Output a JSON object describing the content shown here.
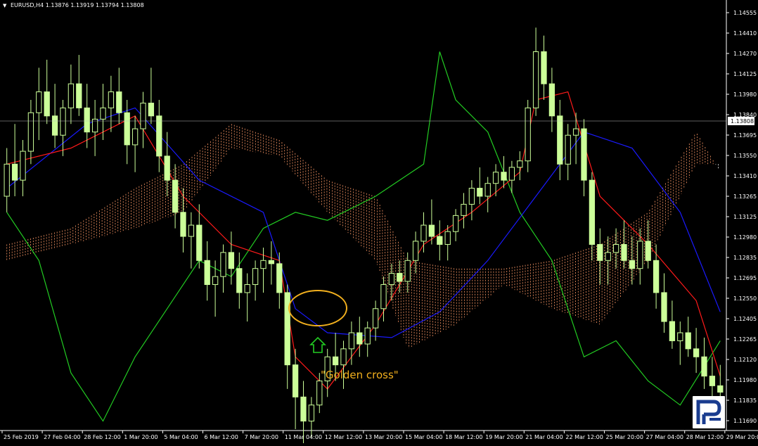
{
  "symbol_info": {
    "symbol": "EURUSD,H4",
    "ohlc": "1.13876 1.13919 1.13794 1.13808"
  },
  "annotation": {
    "label": "\"Golden cross\"",
    "color": "#f2b01e"
  },
  "colors": {
    "background": "#000000",
    "candle": "#ccff99",
    "tenkan": "#ff1a1a",
    "kijun": "#1a1aff",
    "chikou": "#22cc22",
    "cloud_bear": "#ff9966",
    "cloud_bull": "#ffffff",
    "axis": "#ffffff",
    "arrow": "#22cc22"
  },
  "icons": {
    "symbol_menu": "triangle-down-icon",
    "arrow": "arrow-up-icon",
    "logo": "roboforex-logo-icon"
  },
  "chart_data": {
    "type": "candlestick",
    "symbol": "EURUSD",
    "timeframe": "H4",
    "ylim": [
      1.1195,
      1.146
    ],
    "current_price": "1.13808",
    "y_ticks": [
      "1.14555",
      "1.14410",
      "1.14270",
      "1.14125",
      "1.13980",
      "1.13840",
      "1.13695",
      "1.13550",
      "1.13410",
      "1.13265",
      "1.13125",
      "1.12980",
      "1.12835",
      "1.12695",
      "1.12550",
      "1.12405",
      "1.12265",
      "1.12120",
      "1.11980",
      "1.11835",
      "1.11690"
    ],
    "x_ticks": [
      "25 Feb 2019",
      "27 Feb 04:00",
      "28 Feb 12:00",
      "1 Mar 20:00",
      "5 Mar 04:00",
      "6 Mar 12:00",
      "7 Mar 20:00",
      "11 Mar 04:00",
      "12 Mar 12:00",
      "13 Mar 20:00",
      "15 Mar 04:00",
      "18 Mar 12:00",
      "19 Mar 20:00",
      "21 Mar 04:00",
      "22 Mar 12:00",
      "25 Mar 20:00",
      "27 Mar 04:00",
      "28 Mar 12:00",
      "29 Mar 20:00"
    ],
    "candles": [
      [
        1.134,
        1.137,
        1.133,
        1.136
      ],
      [
        1.136,
        1.1385,
        1.134,
        1.135
      ],
      [
        1.135,
        1.1375,
        1.134,
        1.1368
      ],
      [
        1.1368,
        1.14,
        1.136,
        1.1392
      ],
      [
        1.1392,
        1.142,
        1.1375,
        1.1405
      ],
      [
        1.1405,
        1.1425,
        1.1385,
        1.139
      ],
      [
        1.139,
        1.141,
        1.137,
        1.1378
      ],
      [
        1.1378,
        1.14,
        1.1365,
        1.1395
      ],
      [
        1.1395,
        1.1422,
        1.1385,
        1.141
      ],
      [
        1.141,
        1.1428,
        1.139,
        1.1395
      ],
      [
        1.1395,
        1.141,
        1.137,
        1.138
      ],
      [
        1.138,
        1.14,
        1.1365,
        1.1388
      ],
      [
        1.1388,
        1.141,
        1.1375,
        1.1395
      ],
      [
        1.1395,
        1.1415,
        1.138,
        1.1405
      ],
      [
        1.1405,
        1.142,
        1.1385,
        1.1392
      ],
      [
        1.1392,
        1.14,
        1.136,
        1.1372
      ],
      [
        1.1372,
        1.139,
        1.1355,
        1.1382
      ],
      [
        1.1382,
        1.1405,
        1.137,
        1.1398
      ],
      [
        1.1398,
        1.142,
        1.1385,
        1.139
      ],
      [
        1.139,
        1.14,
        1.1355,
        1.1365
      ],
      [
        1.1365,
        1.138,
        1.134,
        1.135
      ],
      [
        1.135,
        1.136,
        1.132,
        1.133
      ],
      [
        1.133,
        1.1345,
        1.1305,
        1.1315
      ],
      [
        1.1315,
        1.133,
        1.1295,
        1.1322
      ],
      [
        1.1322,
        1.1335,
        1.1295,
        1.13
      ],
      [
        1.13,
        1.1312,
        1.1275,
        1.1285
      ],
      [
        1.1285,
        1.13,
        1.1265,
        1.129
      ],
      [
        1.129,
        1.131,
        1.128,
        1.1305
      ],
      [
        1.1305,
        1.1318,
        1.1285,
        1.1295
      ],
      [
        1.1295,
        1.1305,
        1.127,
        1.128
      ],
      [
        1.128,
        1.1292,
        1.1262,
        1.1285
      ],
      [
        1.1285,
        1.13,
        1.1275,
        1.1295
      ],
      [
        1.1295,
        1.1308,
        1.128,
        1.13
      ],
      [
        1.13,
        1.1312,
        1.1285,
        1.1298
      ],
      [
        1.1298,
        1.1305,
        1.127,
        1.128
      ],
      [
        1.128,
        1.1285,
        1.122,
        1.1235
      ],
      [
        1.1235,
        1.1245,
        1.1195,
        1.1215
      ],
      [
        1.1215,
        1.1225,
        1.118,
        1.12
      ],
      [
        1.12,
        1.1215,
        1.119,
        1.121
      ],
      [
        1.121,
        1.123,
        1.1205,
        1.1225
      ],
      [
        1.1225,
        1.1245,
        1.1215,
        1.124
      ],
      [
        1.124,
        1.1255,
        1.1225,
        1.1235
      ],
      [
        1.1235,
        1.125,
        1.122,
        1.1245
      ],
      [
        1.1245,
        1.1262,
        1.1235,
        1.1255
      ],
      [
        1.1255,
        1.1265,
        1.124,
        1.1248
      ],
      [
        1.1248,
        1.1262,
        1.124,
        1.1258
      ],
      [
        1.1258,
        1.1275,
        1.125,
        1.127
      ],
      [
        1.127,
        1.129,
        1.1262,
        1.1285
      ],
      [
        1.1285,
        1.1298,
        1.1275,
        1.1292
      ],
      [
        1.1292,
        1.13,
        1.128,
        1.1287
      ],
      [
        1.1287,
        1.1305,
        1.128,
        1.13
      ],
      [
        1.13,
        1.1318,
        1.1292,
        1.1312
      ],
      [
        1.1312,
        1.133,
        1.1305,
        1.1322
      ],
      [
        1.1322,
        1.1338,
        1.131,
        1.1315
      ],
      [
        1.1315,
        1.1325,
        1.13,
        1.131
      ],
      [
        1.131,
        1.1322,
        1.13,
        1.1318
      ],
      [
        1.1318,
        1.1332,
        1.1312,
        1.1328
      ],
      [
        1.1328,
        1.1342,
        1.132,
        1.1335
      ],
      [
        1.1335,
        1.135,
        1.1325,
        1.1345
      ],
      [
        1.1345,
        1.1358,
        1.1335,
        1.134
      ],
      [
        1.134,
        1.1352,
        1.133,
        1.1348
      ],
      [
        1.1348,
        1.136,
        1.134,
        1.1355
      ],
      [
        1.1355,
        1.1365,
        1.1345,
        1.135
      ],
      [
        1.135,
        1.1362,
        1.1342,
        1.1358
      ],
      [
        1.1358,
        1.1368,
        1.135,
        1.1362
      ],
      [
        1.1362,
        1.14,
        1.1355,
        1.1395
      ],
      [
        1.1395,
        1.1445,
        1.139,
        1.143
      ],
      [
        1.143,
        1.144,
        1.14,
        1.141
      ],
      [
        1.141,
        1.142,
        1.138,
        1.139
      ],
      [
        1.139,
        1.14,
        1.135,
        1.136
      ],
      [
        1.136,
        1.1385,
        1.135,
        1.1378
      ],
      [
        1.1378,
        1.1392,
        1.136,
        1.1382
      ],
      [
        1.1382,
        1.1388,
        1.134,
        1.135
      ],
      [
        1.135,
        1.1355,
        1.13,
        1.131
      ],
      [
        1.131,
        1.132,
        1.1285,
        1.13
      ],
      [
        1.13,
        1.1315,
        1.1285,
        1.1305
      ],
      [
        1.1305,
        1.132,
        1.1295,
        1.131
      ],
      [
        1.131,
        1.1325,
        1.1295,
        1.13
      ],
      [
        1.13,
        1.1315,
        1.1285,
        1.1295
      ],
      [
        1.1295,
        1.132,
        1.1285,
        1.1312
      ],
      [
        1.1312,
        1.1325,
        1.1295,
        1.13
      ],
      [
        1.13,
        1.131,
        1.127,
        1.128
      ],
      [
        1.128,
        1.1292,
        1.1255,
        1.1262
      ],
      [
        1.1262,
        1.1275,
        1.1245,
        1.125
      ],
      [
        1.125,
        1.1262,
        1.1235,
        1.1255
      ],
      [
        1.1255,
        1.1265,
        1.124,
        1.1245
      ],
      [
        1.1245,
        1.1258,
        1.123,
        1.124
      ],
      [
        1.124,
        1.1252,
        1.122,
        1.1228
      ],
      [
        1.1228,
        1.124,
        1.121,
        1.1222
      ],
      [
        1.1222,
        1.1235,
        1.1212,
        1.1218
      ]
    ],
    "tenkan": [
      [
        0,
        1.136
      ],
      [
        8,
        1.137
      ],
      [
        16,
        1.139
      ],
      [
        22,
        1.134
      ],
      [
        28,
        1.131
      ],
      [
        34,
        1.13
      ],
      [
        36,
        1.124
      ],
      [
        40,
        1.122
      ],
      [
        46,
        1.126
      ],
      [
        52,
        1.131
      ],
      [
        58,
        1.133
      ],
      [
        64,
        1.1355
      ],
      [
        66,
        1.14
      ],
      [
        70,
        1.1405
      ],
      [
        74,
        1.134
      ],
      [
        80,
        1.131
      ],
      [
        86,
        1.1275
      ],
      [
        89,
        1.1228
      ]
    ],
    "kijun": [
      [
        0,
        1.1345
      ],
      [
        10,
        1.1385
      ],
      [
        16,
        1.1395
      ],
      [
        24,
        1.135
      ],
      [
        32,
        1.133
      ],
      [
        36,
        1.127
      ],
      [
        40,
        1.1255
      ],
      [
        48,
        1.1252
      ],
      [
        54,
        1.1268
      ],
      [
        60,
        1.13
      ],
      [
        66,
        1.134
      ],
      [
        72,
        1.138
      ],
      [
        78,
        1.137
      ],
      [
        84,
        1.133
      ],
      [
        89,
        1.1268
      ]
    ],
    "chikou": [
      [
        0,
        1.133
      ],
      [
        4,
        1.13
      ],
      [
        8,
        1.123
      ],
      [
        12,
        1.12
      ],
      [
        16,
        1.124
      ],
      [
        20,
        1.127
      ],
      [
        24,
        1.13
      ],
      [
        28,
        1.129
      ],
      [
        32,
        1.132
      ],
      [
        36,
        1.133
      ],
      [
        40,
        1.1325
      ],
      [
        46,
        1.134
      ],
      [
        52,
        1.136
      ],
      [
        54,
        1.143
      ],
      [
        56,
        1.14
      ],
      [
        60,
        1.138
      ],
      [
        64,
        1.133
      ],
      [
        68,
        1.13
      ],
      [
        72,
        1.124
      ],
      [
        76,
        1.125
      ],
      [
        80,
        1.1225
      ],
      [
        84,
        1.121
      ],
      [
        89,
        1.125
      ]
    ],
    "cloud_a": [
      [
        0,
        1.131
      ],
      [
        8,
        1.132
      ],
      [
        16,
        1.1345
      ],
      [
        22,
        1.136
      ],
      [
        28,
        1.1385
      ],
      [
        34,
        1.1375
      ],
      [
        40,
        1.135
      ],
      [
        46,
        1.134
      ],
      [
        50,
        1.13
      ],
      [
        56,
        1.1295
      ],
      [
        62,
        1.1295
      ],
      [
        68,
        1.13
      ],
      [
        74,
        1.131
      ],
      [
        80,
        1.133
      ],
      [
        86,
        1.138
      ],
      [
        89,
        1.1355
      ]
    ],
    "cloud_b": [
      [
        0,
        1.13
      ],
      [
        8,
        1.131
      ],
      [
        16,
        1.132
      ],
      [
        22,
        1.133
      ],
      [
        28,
        1.137
      ],
      [
        34,
        1.1365
      ],
      [
        40,
        1.133
      ],
      [
        46,
        1.13
      ],
      [
        50,
        1.1245
      ],
      [
        56,
        1.126
      ],
      [
        62,
        1.1285
      ],
      [
        68,
        1.127
      ],
      [
        74,
        1.126
      ],
      [
        80,
        1.13
      ],
      [
        86,
        1.136
      ],
      [
        89,
        1.136
      ]
    ]
  }
}
